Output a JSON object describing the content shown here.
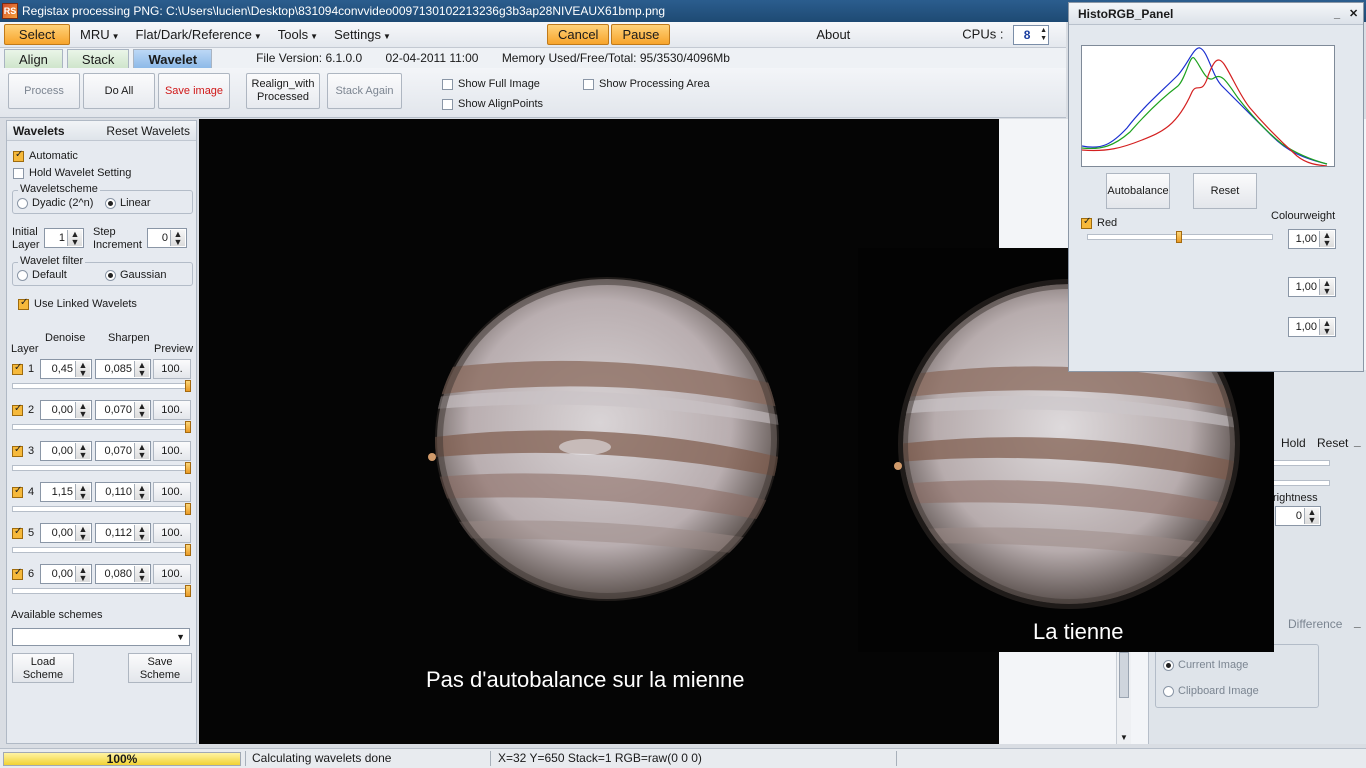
{
  "window": {
    "title": "Registax processing PNG: C:\\Users\\lucien\\Desktop\\831094convvideo0097130102213236g3b3ap28NIVEAUX61bmp.png",
    "icon_letters": "RS"
  },
  "menu": {
    "select": "Select",
    "mru": "MRU",
    "flat": "Flat/Dark/Reference",
    "tools": "Tools",
    "settings": "Settings",
    "cancel": "Cancel",
    "pause": "Pause",
    "about": "About",
    "cpus_label": "CPUs :",
    "cpus_value": "8"
  },
  "tabs": [
    "Align",
    "Stack",
    "Wavelet"
  ],
  "info": {
    "version": "File Version: 6.1.0.0",
    "date": "02-04-2011 11:00",
    "memory": "Memory Used/Free/Total: 95/3530/4096Mb"
  },
  "toolbar": {
    "process": "Process",
    "do_all": "Do All",
    "save_image": "Save image",
    "realign_1": "Realign_with",
    "realign_2": "Processed",
    "stack_again": "Stack Again",
    "show_full": "Show Full Image",
    "show_align": "Show AlignPoints",
    "show_area": "Show Processing Area"
  },
  "wavelets": {
    "title": "Wavelets",
    "reset": "Reset Wavelets",
    "automatic": "Automatic",
    "hold": "Hold Wavelet Setting",
    "scheme_legend": "Waveletscheme",
    "dyadic": "Dyadic (2^n)",
    "linear": "Linear",
    "initial_1": "Initial",
    "initial_2": "Layer",
    "initial_value": "1",
    "step_1": "Step",
    "step_2": "Increment",
    "step_value": "0",
    "filter_legend": "Wavelet filter",
    "default": "Default",
    "gaussian": "Gaussian",
    "linked": "Use Linked Wavelets",
    "col_layer": "Layer",
    "col_denoise": "Denoise",
    "col_sharpen": "Sharpen",
    "col_preview": "Preview",
    "layers": [
      {
        "n": "1",
        "denoise": "0,45",
        "sharpen": "0,085",
        "preview": "100."
      },
      {
        "n": "2",
        "denoise": "0,00",
        "sharpen": "0,070",
        "preview": "100."
      },
      {
        "n": "3",
        "denoise": "0,00",
        "sharpen": "0,070",
        "preview": "100."
      },
      {
        "n": "4",
        "denoise": "1,15",
        "sharpen": "0,110",
        "preview": "100."
      },
      {
        "n": "5",
        "denoise": "0,00",
        "sharpen": "0,112",
        "preview": "100."
      },
      {
        "n": "6",
        "denoise": "0,00",
        "sharpen": "0,080",
        "preview": "100."
      }
    ],
    "available": "Available schemes",
    "load_1": "Load",
    "load_2": "Scheme",
    "save_1": "Save",
    "save_2": "Scheme"
  },
  "image": {
    "caption_left": "Pas d'autobalance sur la mienne",
    "caption_right": "La tienne"
  },
  "histo": {
    "title": "HistoRGB_Panel",
    "min": "_",
    "close": "✕",
    "autobalance": "Autobalance",
    "reset": "Reset",
    "red": "Red",
    "colourweight": "Colourweight",
    "weights": [
      "1,00",
      "1,00",
      "1,00"
    ],
    "colors": {
      "red": "#d42020",
      "green": "#1ea21e",
      "blue": "#1a2fd0"
    }
  },
  "right_panel": {
    "hold": "Hold",
    "reset": "Reset",
    "min": "_",
    "brightness": "rightness",
    "brightness_value": "0",
    "difference": "Difference",
    "current_image": "Current Image",
    "clipboard_image": "Clipboard Image"
  },
  "status": {
    "progress_label": "100%",
    "progress": 1.0,
    "message": "Calculating wavelets done",
    "coords": "X=32 Y=650 Stack=1 RGB=raw(0 0 0)"
  }
}
